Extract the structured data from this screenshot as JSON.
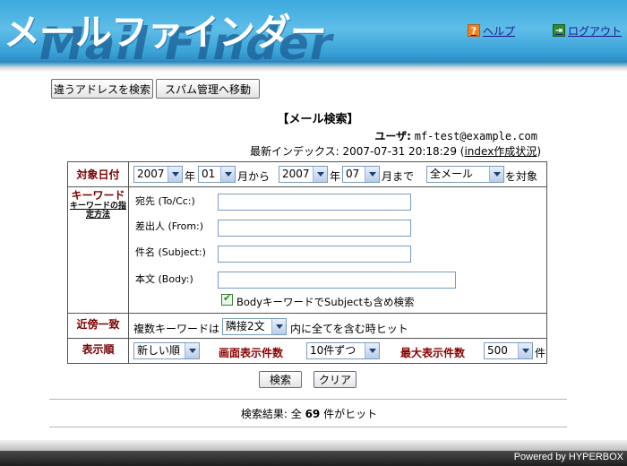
{
  "header": {
    "title": "メールファインダー",
    "ghost_title": "Mail Finder",
    "help": "ヘルプ",
    "logout": "ログアウト"
  },
  "toolbar": {
    "search_other": "違うアドレスを検索",
    "spam": "スパム管理へ移動"
  },
  "page": {
    "title": "【メール検索】",
    "user_label": "ユーザ:",
    "user_value": "mf-test@example.com",
    "index_label": "最新インデックス:",
    "index_value": "2007-07-31 20:18:29",
    "index_open": "(",
    "index_link": "index作成状況",
    "index_close": ")"
  },
  "form": {
    "date": {
      "label": "対象日付",
      "from_year": "2007",
      "year_unit": "年",
      "from_month": "01",
      "month_from": "月から",
      "to_year": "2007",
      "year_unit2": "年",
      "to_month": "07",
      "month_to": "月まで",
      "scope": "全メール",
      "scope_suffix": "を対象"
    },
    "keyword": {
      "label": "キーワード",
      "help_link": "キーワードの指定方法",
      "to_label": "宛先 (To/Cc:)",
      "to_value": "",
      "from_label": "差出人 (From:)",
      "from_value": "",
      "subject_label": "件名 (Subject:)",
      "subject_value": "",
      "body_label": "本文 (Body:)",
      "body_value": "",
      "checkbox_label": "BodyキーワードでSubjectも含め検索",
      "checkbox_checked": true
    },
    "proximity": {
      "label": "近傍一致",
      "prefix": "複数キーワードは",
      "value": "隣接2文",
      "suffix": "内に全てを含む時ヒット"
    },
    "sort": {
      "label": "表示順",
      "order": "新しい順",
      "per_page_label": "画面表示件数",
      "per_page": "10件ずつ",
      "max_label": "最大表示件数",
      "max": "500",
      "max_unit": "件"
    }
  },
  "actions": {
    "search": "検索",
    "clear": "クリア"
  },
  "result": {
    "prefix": "検索結果: 全",
    "count": "69",
    "suffix": "件がヒット"
  },
  "footer": {
    "powered": "Powered by HYPERBOX"
  }
}
